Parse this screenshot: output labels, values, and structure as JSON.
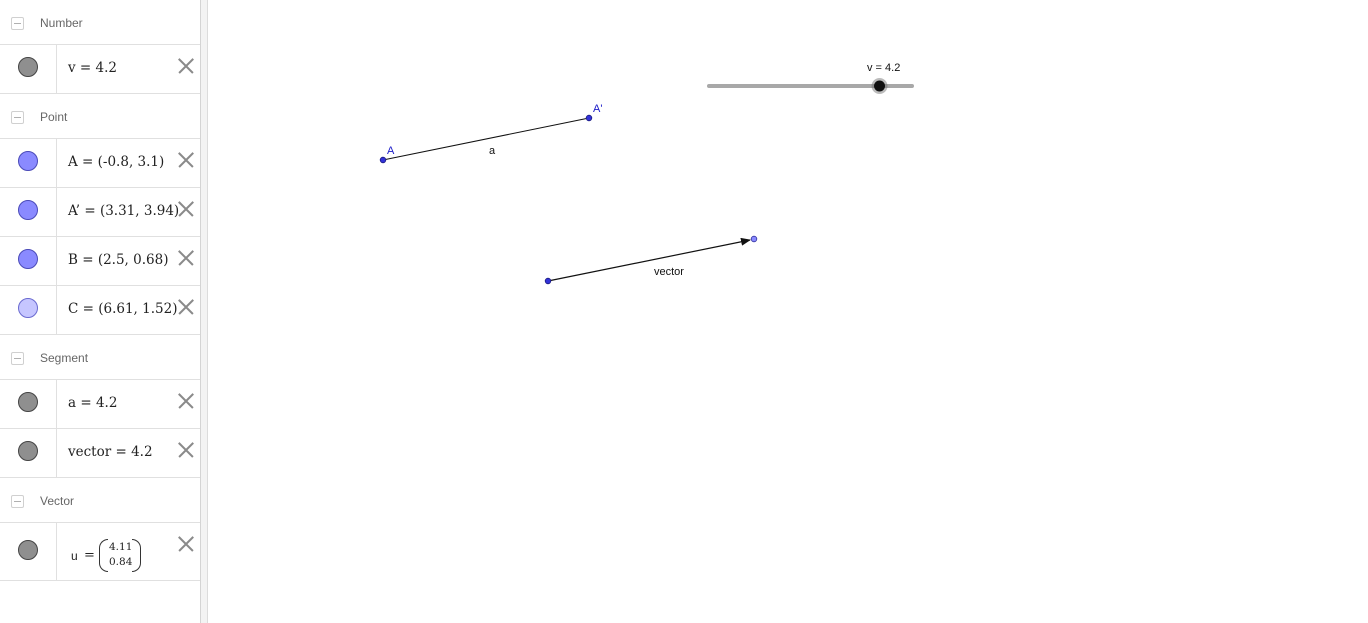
{
  "algebra": {
    "groups": {
      "number": "Number",
      "point": "Point",
      "segment": "Segment",
      "vector": "Vector"
    },
    "items": {
      "v": "v = 4.2",
      "A": "A = (-0.8, 3.1)",
      "A_prime": "A’ = (3.31, 3.94)",
      "B": "B = (2.5, 0.68)",
      "C": "C = (6.61, 1.52)",
      "a": "a = 4.2",
      "vector": "vector = 4.2"
    },
    "vector_u": {
      "name": "u",
      "equals": "=",
      "x": "4.11",
      "y": "0.84"
    },
    "colors": {
      "point_fill": "#8a8aff",
      "point_fill_light": "#c6c6ff",
      "object_fill": "#8f8f8f",
      "point_label": "#1a1ac8"
    }
  },
  "graphics": {
    "slider": {
      "label": "v = 4.2",
      "value": 4.2,
      "min": 0,
      "max": 5
    },
    "labels": {
      "point_A": "A",
      "point_A_prime": "A'",
      "segment_a": "a",
      "segment_vector": "vector"
    }
  }
}
